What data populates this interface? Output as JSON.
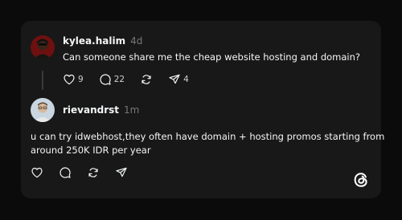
{
  "post": {
    "username": "kylea.halim",
    "time": "4d",
    "text": "Can someone share me the cheap website hosting and domain?",
    "likes": "9",
    "replies": "22",
    "shares": "4"
  },
  "reply": {
    "username": "rievandrst",
    "time": "1m",
    "text_line1": "u can try idwebhost,they often have domain + hosting promos starting from",
    "text_line2": "around 250K IDR per year"
  },
  "icons": {
    "like": "heart-icon",
    "reply": "comment-icon",
    "repost": "repost-icon",
    "share": "send-icon",
    "brand": "threads-logo"
  },
  "colors": {
    "background": "#0b0b0b",
    "card": "#181818",
    "text": "#f3f5f7",
    "muted": "#777777"
  }
}
